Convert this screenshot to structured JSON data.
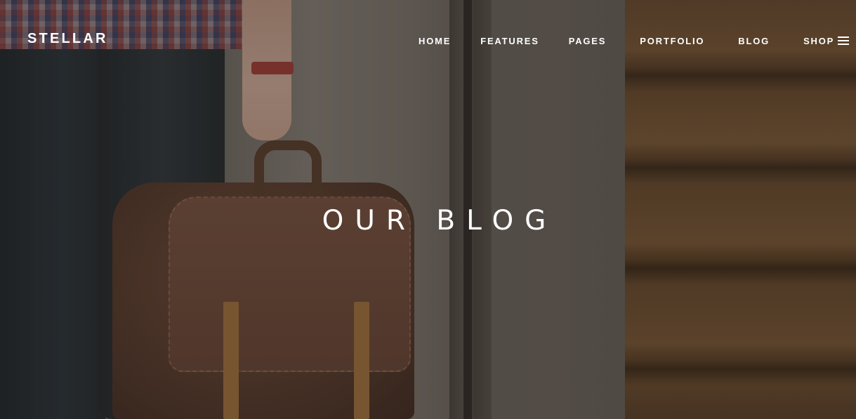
{
  "brand": {
    "logo_text": "STELLAR"
  },
  "nav": {
    "items": [
      {
        "label": "HOME"
      },
      {
        "label": "FEATURES"
      },
      {
        "label": "PAGES"
      },
      {
        "label": "PORTFOLIO"
      },
      {
        "label": "BLOG"
      },
      {
        "label": "SHOP"
      }
    ],
    "menu_icon": "hamburger-menu-icon"
  },
  "hero": {
    "title": "OUR BLOG",
    "image_subject": "person holding brown leather backpack"
  },
  "colors": {
    "text": "#ffffff",
    "overlay": "#28221e"
  }
}
